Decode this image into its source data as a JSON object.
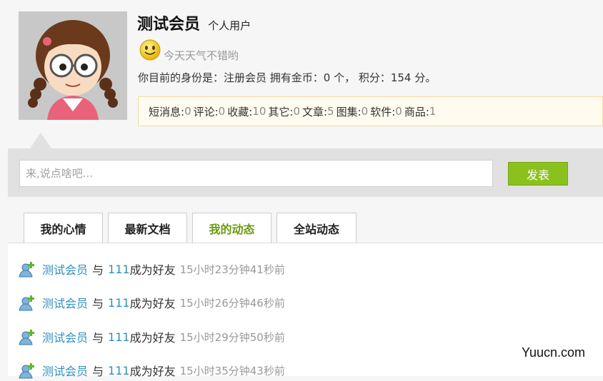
{
  "profile": {
    "name": "测试会员",
    "user_type": "个人用户",
    "mood": "今天天气不错哟",
    "identity_line": "你目前的身份是：注册会员 拥有金币：0 个， 积分：154 分。"
  },
  "stats": [
    {
      "label": "短消息:",
      "value": "0"
    },
    {
      "label": "评论:",
      "value": "0"
    },
    {
      "label": "收藏:",
      "value": "10"
    },
    {
      "label": "其它:",
      "value": "0"
    },
    {
      "label": "文章:",
      "value": "5"
    },
    {
      "label": "图集:",
      "value": "0"
    },
    {
      "label": "软件:",
      "value": "0"
    },
    {
      "label": "商品:",
      "value": "1"
    }
  ],
  "post": {
    "placeholder": "来,说点啥吧...",
    "button_label": "发表"
  },
  "tabs": [
    {
      "label": "我的心情"
    },
    {
      "label": "最新文档"
    },
    {
      "label": "我的动态"
    },
    {
      "label": "全站动态"
    }
  ],
  "active_tab": "我的动态",
  "feed": [
    {
      "actor": "测试会员",
      "conj": "与",
      "target": "111",
      "action": "成为好友",
      "time": "15小时23分钟41秒前"
    },
    {
      "actor": "测试会员",
      "conj": "与",
      "target": "111",
      "action": "成为好友",
      "time": "15小时26分钟46秒前"
    },
    {
      "actor": "测试会员",
      "conj": "与",
      "target": "111",
      "action": "成为好友",
      "time": "15小时29分钟50秒前"
    },
    {
      "actor": "测试会员",
      "conj": "与",
      "target": "111",
      "action": "成为好友",
      "time": "15小时35分钟43秒前"
    }
  ],
  "watermark": "Yuucn.com"
}
